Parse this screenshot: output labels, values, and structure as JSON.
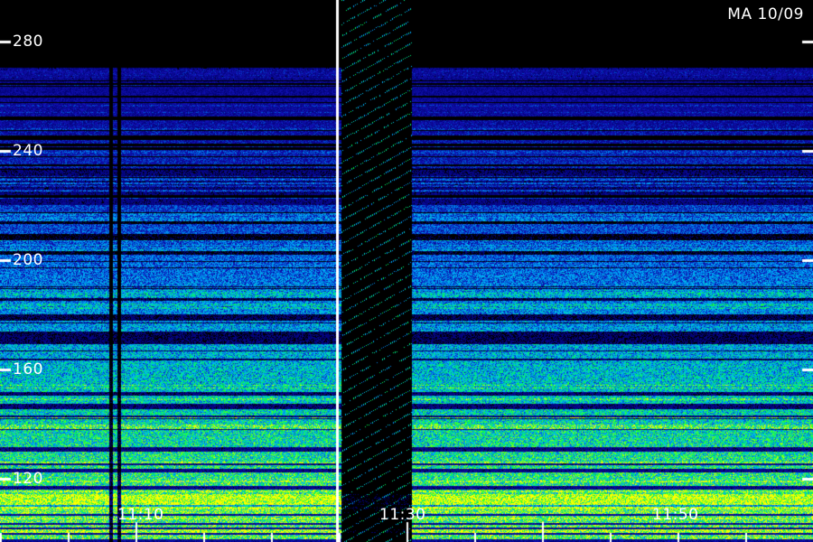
{
  "station_label": "MA 10/09",
  "y_axis": {
    "labels": [
      "280",
      "240",
      "200",
      "160",
      "120"
    ],
    "values": [
      280,
      240,
      200,
      160,
      120
    ],
    "range": [
      108,
      292
    ]
  },
  "x_axis": {
    "labels": [
      "11:10",
      "11:30",
      "11:50"
    ]
  },
  "colors": {
    "background": "#000000",
    "low": "#1a1aa0",
    "mid": "#00b4ff",
    "high": "#00ff60",
    "peak": "#ffff00",
    "separator": "#ffffff",
    "ticks": "#ffffff"
  }
}
